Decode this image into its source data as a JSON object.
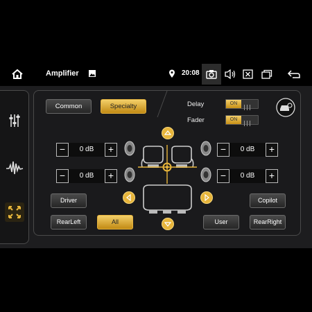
{
  "status_bar": {
    "title": "Amplifier",
    "time": "20:08",
    "icons": [
      "home-icon",
      "image-icon",
      "location-pin-icon",
      "camera-icon",
      "volume-icon",
      "close-box-icon",
      "windows-icon",
      "back-icon"
    ]
  },
  "sidebar": {
    "items": [
      {
        "name": "equalizer-sliders-icon"
      },
      {
        "name": "waveform-icon"
      },
      {
        "name": "sound-field-icon",
        "active": true
      }
    ]
  },
  "mode_tabs": {
    "common": "Common",
    "specialty": "Specialty",
    "selected": "Specialty"
  },
  "settings": {
    "delay_label": "Delay",
    "delay_state": "ON",
    "fader_label": "Fader",
    "fader_state": "ON"
  },
  "volumes": {
    "front_left": "0 dB",
    "front_right": "0 dB",
    "rear_left": "0 dB",
    "rear_right": "0 dB"
  },
  "positions": {
    "driver": "Driver",
    "copilot": "Copilot",
    "rear_left": "RearLeft",
    "all": "All",
    "user": "User",
    "rear_right": "RearRight",
    "selected": "All"
  },
  "colors": {
    "accent": "#e7b53b",
    "panel": "#1a1a1c",
    "background": "#000000"
  }
}
